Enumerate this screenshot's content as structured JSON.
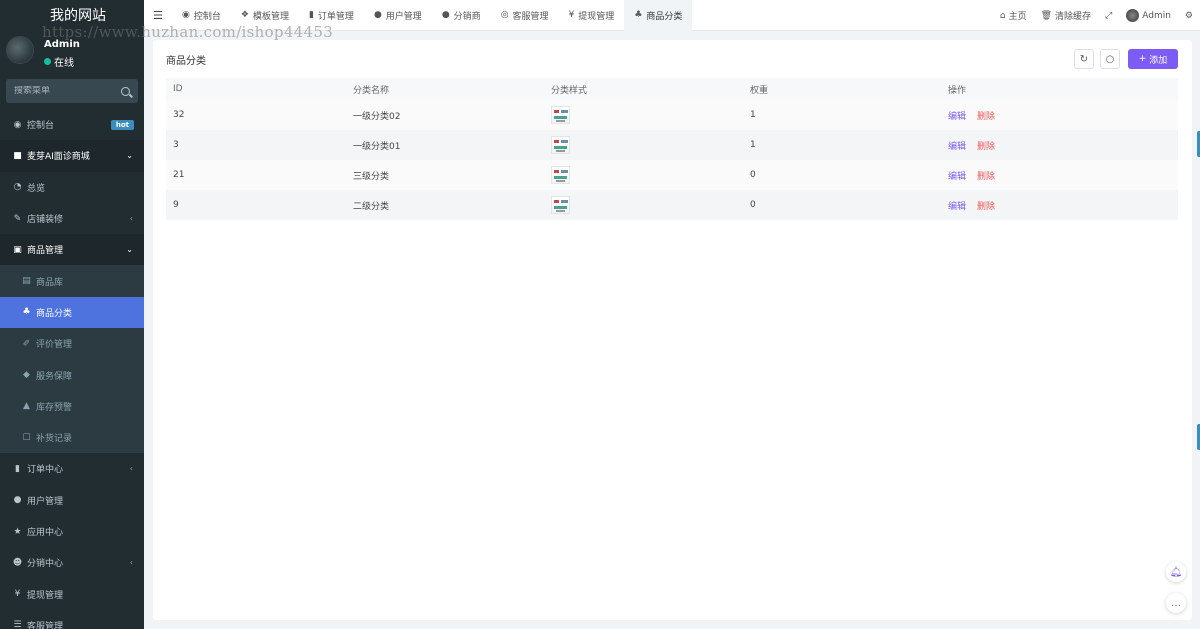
{
  "sidebar": {
    "brand": "我的网站",
    "user": {
      "name": "Admin",
      "status": "在线"
    },
    "search_placeholder": "搜索菜单",
    "items": [
      {
        "label": "控制台",
        "icon": "dashboard-icon",
        "glyph": "◉",
        "badge": "hot",
        "type": "top"
      },
      {
        "label": "麦芽AI面诊商城",
        "icon": "briefcase-icon",
        "glyph": "■",
        "caret": "⌄",
        "type": "parent"
      },
      {
        "label": "总览",
        "icon": "pie-chart-icon",
        "glyph": "◔",
        "type": "top"
      },
      {
        "label": "店铺装修",
        "icon": "brush-icon",
        "glyph": "✎",
        "caret": "‹",
        "type": "top"
      },
      {
        "label": "商品管理",
        "icon": "archive-icon",
        "glyph": "▣",
        "caret": "⌄",
        "type": "parent"
      },
      {
        "label": "商品库",
        "icon": "shopping-bag-icon",
        "glyph": "▤",
        "type": "sub"
      },
      {
        "label": "商品分类",
        "icon": "sitemap-icon",
        "glyph": "♣",
        "type": "active"
      },
      {
        "label": "评价管理",
        "icon": "edit-square-icon",
        "glyph": "✐",
        "type": "sub"
      },
      {
        "label": "服务保障",
        "icon": "tag-icon",
        "glyph": "◆",
        "type": "sub"
      },
      {
        "label": "库存预警",
        "icon": "warning-icon",
        "glyph": "▲",
        "type": "sub"
      },
      {
        "label": "补货记录",
        "icon": "checkbox-icon",
        "glyph": "☐",
        "type": "sub"
      },
      {
        "label": "订单中心",
        "icon": "file-icon",
        "glyph": "▮",
        "caret": "‹",
        "type": "top"
      },
      {
        "label": "用户管理",
        "icon": "user-icon",
        "glyph": "●",
        "type": "top"
      },
      {
        "label": "应用中心",
        "icon": "star-icon",
        "glyph": "★",
        "type": "top"
      },
      {
        "label": "分销中心",
        "icon": "users-icon",
        "glyph": "☻",
        "caret": "‹",
        "type": "top"
      },
      {
        "label": "提现管理",
        "icon": "yen-icon",
        "glyph": "¥",
        "type": "top"
      },
      {
        "label": "客服管理",
        "icon": "list-icon",
        "glyph": "☰",
        "type": "top"
      }
    ]
  },
  "topbar": {
    "menu_icon": "☰",
    "tabs": [
      {
        "label": "控制台",
        "icon": "dashboard-icon",
        "glyph": "◉"
      },
      {
        "label": "模板管理",
        "icon": "cubes-icon",
        "glyph": "❖"
      },
      {
        "label": "订单管理",
        "icon": "file-icon",
        "glyph": "▮"
      },
      {
        "label": "用户管理",
        "icon": "user-icon",
        "glyph": "●"
      },
      {
        "label": "分销商",
        "icon": "user-icon",
        "glyph": "●"
      },
      {
        "label": "客服管理",
        "icon": "user-circle-icon",
        "glyph": "◎"
      },
      {
        "label": "提现管理",
        "icon": "yen-icon",
        "glyph": "¥"
      },
      {
        "label": "商品分类",
        "icon": "sitemap-icon",
        "glyph": "♣",
        "active": true
      }
    ],
    "right": {
      "home": "主页",
      "clear_cache": "清除缓存",
      "fullscreen_icon": "⤢",
      "admin": "Admin",
      "settings_icon": "⚙"
    }
  },
  "panel": {
    "title": "商品分类",
    "add_label": "添加",
    "refresh_icon": "↻",
    "search_icon": "○",
    "columns": [
      "ID",
      "分类名称",
      "分类样式",
      "权重",
      "操作"
    ],
    "rows": [
      {
        "id": "32",
        "name": "一级分类02",
        "weight": "1",
        "edit": "编辑",
        "delete": "删除"
      },
      {
        "id": "3",
        "name": "一级分类01",
        "weight": "1",
        "edit": "编辑",
        "delete": "删除"
      },
      {
        "id": "21",
        "name": "三级分类",
        "weight": "0",
        "edit": "编辑",
        "delete": "删除"
      },
      {
        "id": "9",
        "name": "二级分类",
        "weight": "0",
        "edit": "编辑",
        "delete": "删除"
      }
    ]
  },
  "watermark": "https://www.huzhan.com/ishop44453",
  "colors": {
    "sidebar": "#222d32",
    "active": "#4e73df",
    "accent": "#7c5cf5",
    "danger": "#f05a5a"
  }
}
